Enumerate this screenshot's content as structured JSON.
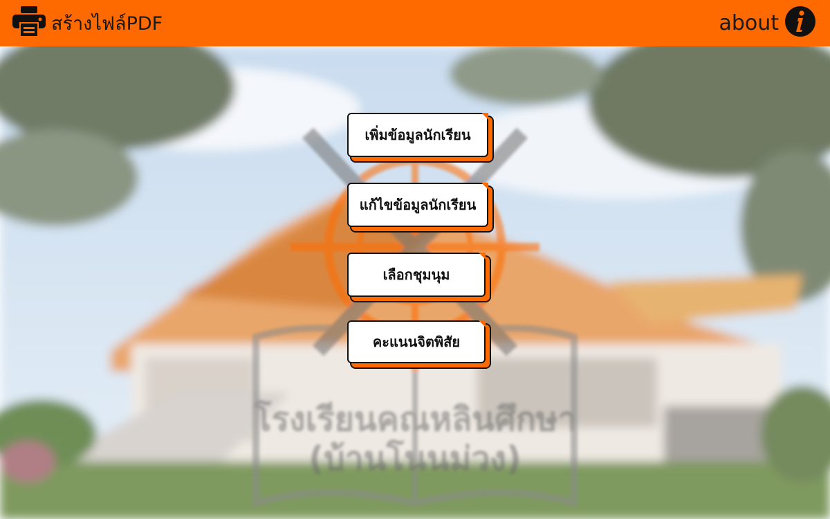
{
  "topbar": {
    "pdf_label": "สร้างไฟล์PDF",
    "about_label": "about",
    "background_color": "#ff6a00"
  },
  "menu": {
    "items": [
      {
        "label": "เพิ่มข้อมูลนักเรียน"
      },
      {
        "label": "แก้ไขข้อมูลนักเรียน"
      },
      {
        "label": "เลือกชุมนุม"
      },
      {
        "label": "คะแนนจิตพิสัย"
      }
    ]
  },
  "school": {
    "name_line1": "โรงเรียนคณหลินศึกษา",
    "name_line2": "(บ้านโนนม่วง)"
  }
}
